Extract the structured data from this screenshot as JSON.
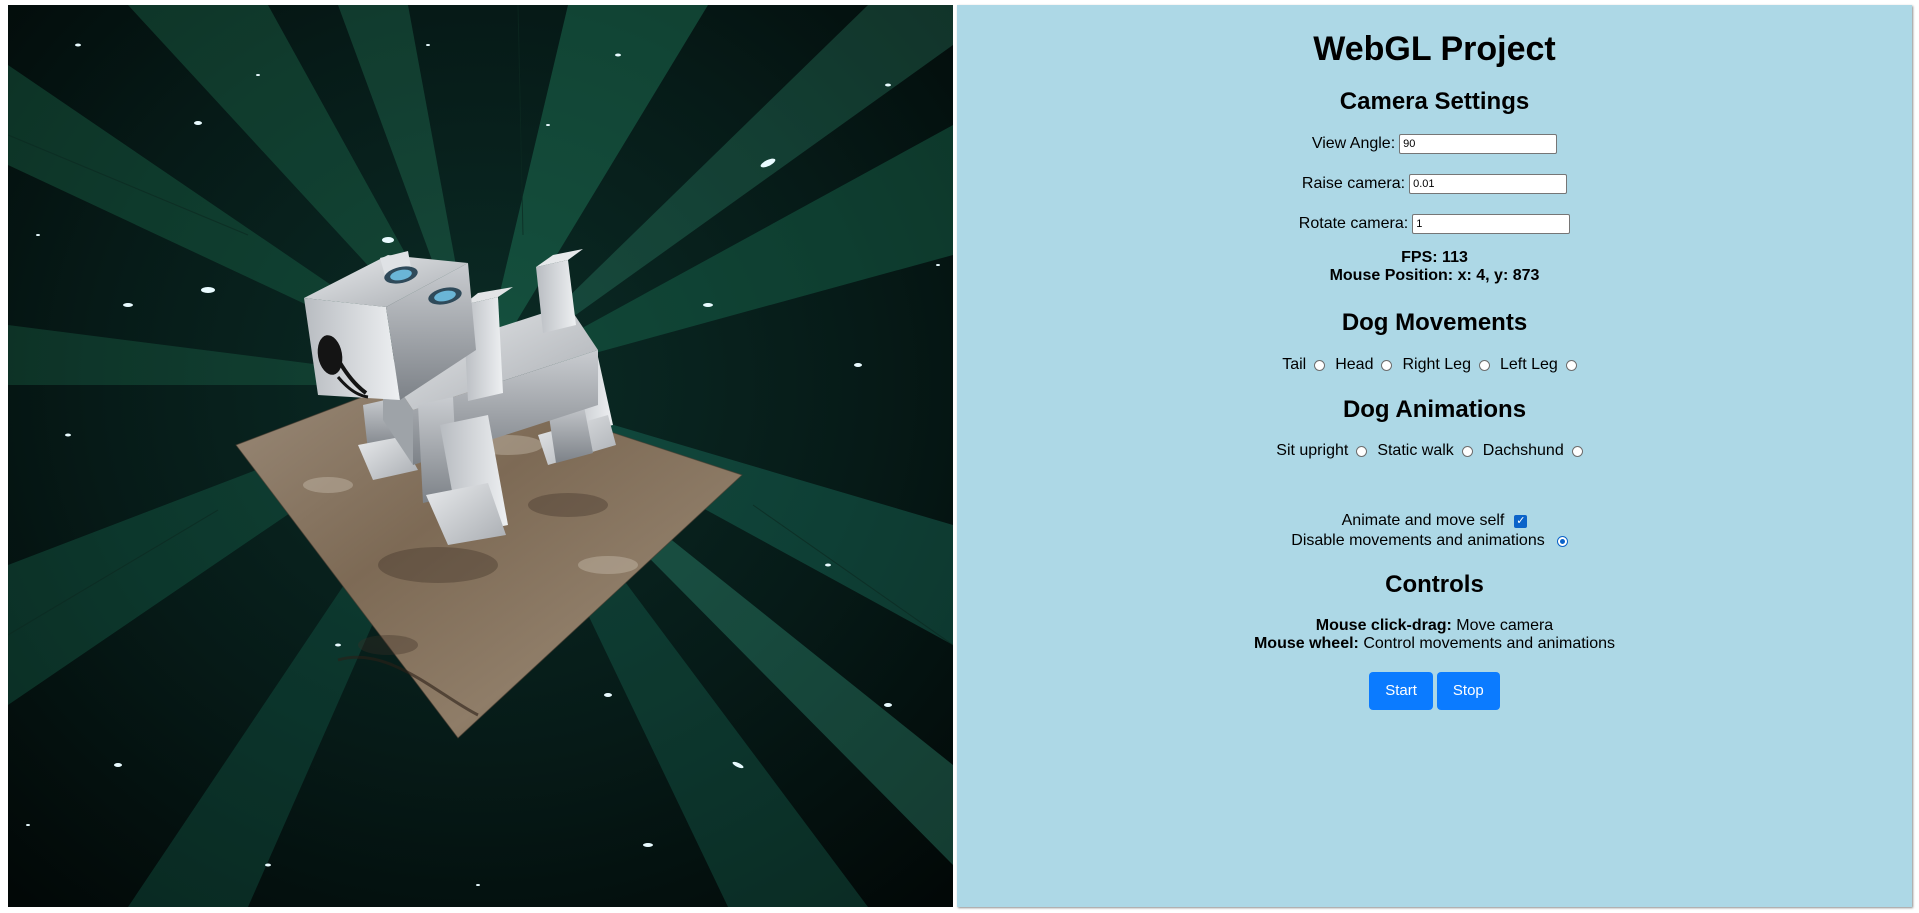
{
  "panel": {
    "title": "WebGL Project",
    "camera_settings": {
      "heading": "Camera Settings",
      "view_angle": {
        "label": "View Angle:",
        "value": "90"
      },
      "raise_camera": {
        "label": "Raise camera:",
        "value": "0.01"
      },
      "rotate_camera": {
        "label": "Rotate camera:",
        "value": "1"
      }
    },
    "stats": {
      "fps_label": "FPS:",
      "fps_value": "113",
      "mouse_label": "Mouse Position:",
      "mouse_value": "x: 4, y: 873"
    },
    "dog_movements": {
      "heading": "Dog Movements",
      "options": [
        {
          "label": "Tail",
          "checked": false
        },
        {
          "label": "Head",
          "checked": false
        },
        {
          "label": "Right Leg",
          "checked": false
        },
        {
          "label": "Left Leg",
          "checked": false
        }
      ]
    },
    "dog_animations": {
      "heading": "Dog Animations",
      "options": [
        {
          "label": "Sit upright",
          "checked": false
        },
        {
          "label": "Static walk",
          "checked": false
        },
        {
          "label": "Dachshund",
          "checked": false
        }
      ]
    },
    "animate_self": {
      "label": "Animate and move self",
      "checked": true
    },
    "disable_all": {
      "label": "Disable movements and animations",
      "checked": true
    },
    "controls": {
      "heading": "Controls",
      "drag_label": "Mouse click-drag:",
      "drag_text": "Move camera",
      "wheel_label": "Mouse wheel:",
      "wheel_text": "Control movements and animations"
    },
    "buttons": {
      "start": "Start",
      "stop": "Stop"
    }
  },
  "colors": {
    "panel_bg": "#add8e6",
    "button_bg": "#0b7bff",
    "accent": "#0b63c9"
  }
}
